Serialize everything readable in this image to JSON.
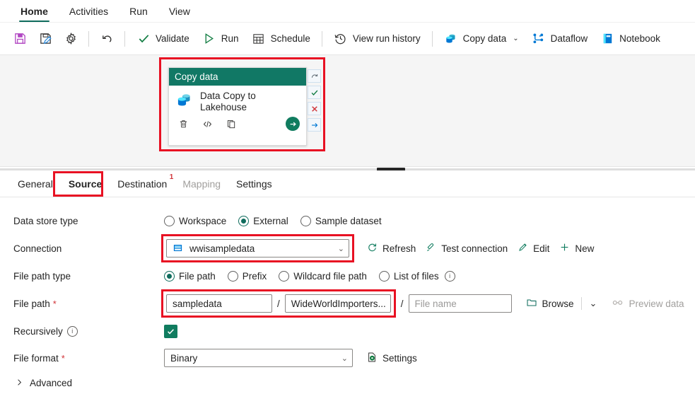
{
  "ribbon": {
    "tabs": [
      {
        "label": "Home",
        "active": true
      },
      {
        "label": "Activities",
        "active": false
      },
      {
        "label": "Run",
        "active": false
      },
      {
        "label": "View",
        "active": false
      }
    ]
  },
  "commandbar": {
    "items": [
      {
        "name": "save",
        "label": "",
        "icon": "save-icon"
      },
      {
        "name": "save-as",
        "label": "",
        "icon": "save-as-icon"
      },
      {
        "name": "settings",
        "label": "",
        "icon": "gear-icon"
      },
      {
        "name": "undo",
        "label": "",
        "icon": "undo-icon"
      },
      {
        "name": "validate",
        "label": "Validate",
        "icon": "checkmark-icon"
      },
      {
        "name": "run",
        "label": "Run",
        "icon": "play-icon"
      },
      {
        "name": "schedule",
        "label": "Schedule",
        "icon": "calendar-icon"
      },
      {
        "name": "view-run-history",
        "label": "View run history",
        "icon": "history-icon"
      },
      {
        "name": "copy-data",
        "label": "Copy data",
        "icon": "copy-data-icon"
      },
      {
        "name": "dataflow",
        "label": "Dataflow",
        "icon": "dataflow-icon"
      },
      {
        "name": "notebook",
        "label": "Notebook",
        "icon": "notebook-icon"
      }
    ]
  },
  "canvas": {
    "activity": {
      "header": "Copy data",
      "title": "Data Copy to Lakehouse",
      "tools": [
        "delete-icon",
        "code-icon",
        "duplicate-icon"
      ],
      "run_button": "run-arrow-icon",
      "ports": [
        "on-completion-port",
        "on-success-port",
        "on-failure-port",
        "on-skip-port"
      ]
    },
    "highlight_color": "#e81123"
  },
  "detail_tabs": [
    {
      "label": "General",
      "active": false,
      "disabled": false,
      "badge": ""
    },
    {
      "label": "Source",
      "active": true,
      "disabled": false,
      "badge": ""
    },
    {
      "label": "Destination",
      "active": false,
      "disabled": false,
      "badge": "1"
    },
    {
      "label": "Mapping",
      "active": false,
      "disabled": true,
      "badge": ""
    },
    {
      "label": "Settings",
      "active": false,
      "disabled": false,
      "badge": ""
    }
  ],
  "source": {
    "data_store_type": {
      "label": "Data store type",
      "options": [
        {
          "label": "Workspace",
          "selected": false
        },
        {
          "label": "External",
          "selected": true
        },
        {
          "label": "Sample dataset",
          "selected": false
        }
      ]
    },
    "connection": {
      "label": "Connection",
      "value": "wwisampledata",
      "icon": "azure-blob-storage-icon",
      "actions": [
        {
          "label": "Refresh",
          "icon": "refresh-icon",
          "disabled": false
        },
        {
          "label": "Test connection",
          "icon": "test-connection-icon",
          "disabled": false
        },
        {
          "label": "Edit",
          "icon": "pencil-icon",
          "disabled": false
        },
        {
          "label": "New",
          "icon": "plus-icon",
          "disabled": false
        }
      ]
    },
    "file_path_type": {
      "label": "File path type",
      "options": [
        {
          "label": "File path",
          "selected": true,
          "info": false
        },
        {
          "label": "Prefix",
          "selected": false,
          "info": false
        },
        {
          "label": "Wildcard file path",
          "selected": false,
          "info": false
        },
        {
          "label": "List of files",
          "selected": false,
          "info": true
        }
      ]
    },
    "file_path": {
      "label": "File path",
      "required": "*",
      "container": "sampledata",
      "directory": "WideWorldImporters...",
      "file_name_placeholder": "File name",
      "file_name_value": "",
      "separator": "/",
      "browse_label": "Browse",
      "browse_caret": "chevron-down-icon",
      "preview_label": "Preview data",
      "preview_disabled": true
    },
    "recursively": {
      "label": "Recursively",
      "checked": true,
      "info": true
    },
    "file_format": {
      "label": "File format",
      "required": "*",
      "value": "Binary",
      "settings_label": "Settings"
    },
    "advanced": {
      "label": "Advanced",
      "expanded": false
    }
  }
}
